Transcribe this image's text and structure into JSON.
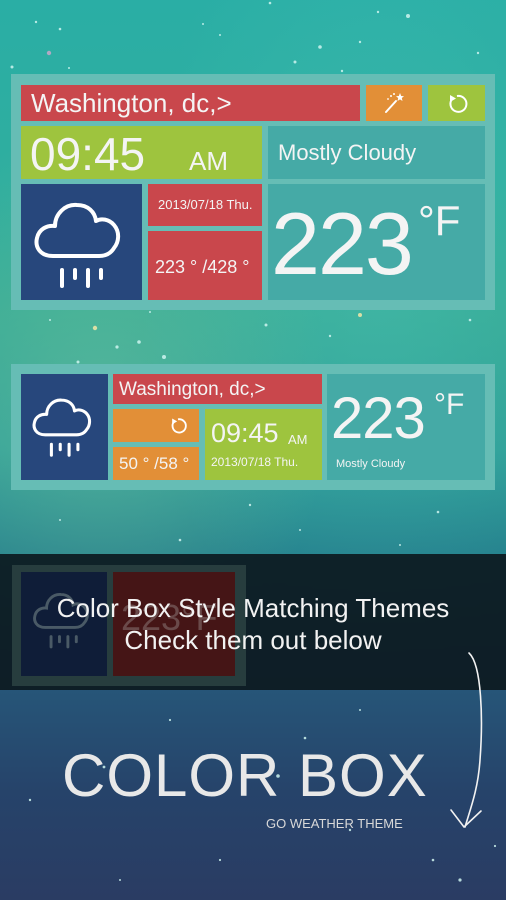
{
  "colors": {
    "frame": "#66bdb5",
    "red": "#c9474c",
    "orange": "#e28f37",
    "green": "#9ec43e",
    "teal": "#45aaa6",
    "navy": "#27477c"
  },
  "widget_large": {
    "location": "Washington, dc,>",
    "theme_button_icon": "magic-wand-icon",
    "refresh_button_icon": "refresh-icon",
    "time": "09:45",
    "ampm": "AM",
    "condition": "Mostly Cloudy",
    "weather_icon": "cloud-rain-icon",
    "date": "2013/07/18 Thu.",
    "low_high": "223 ° /428 °",
    "temperature": "223",
    "unit": "°F"
  },
  "widget_small": {
    "weather_icon": "cloud-rain-icon",
    "location": "Washington, dc,>",
    "refresh_button_icon": "refresh-icon",
    "low_high": "50 ° /58 °",
    "time": "09:45",
    "ampm": "AM",
    "date": "2013/07/18 Thu.",
    "temperature": "223",
    "unit": "°F",
    "condition": "Mostly Cloudy"
  },
  "banner": {
    "line1": "Color Box Style Matching Themes",
    "line2": "Check them out below",
    "ghost_temperature": "223°F"
  },
  "footer": {
    "title": "COLOR BOX",
    "subtitle": "GO WEATHER THEME",
    "arrow_icon": "arrow-down-icon"
  }
}
